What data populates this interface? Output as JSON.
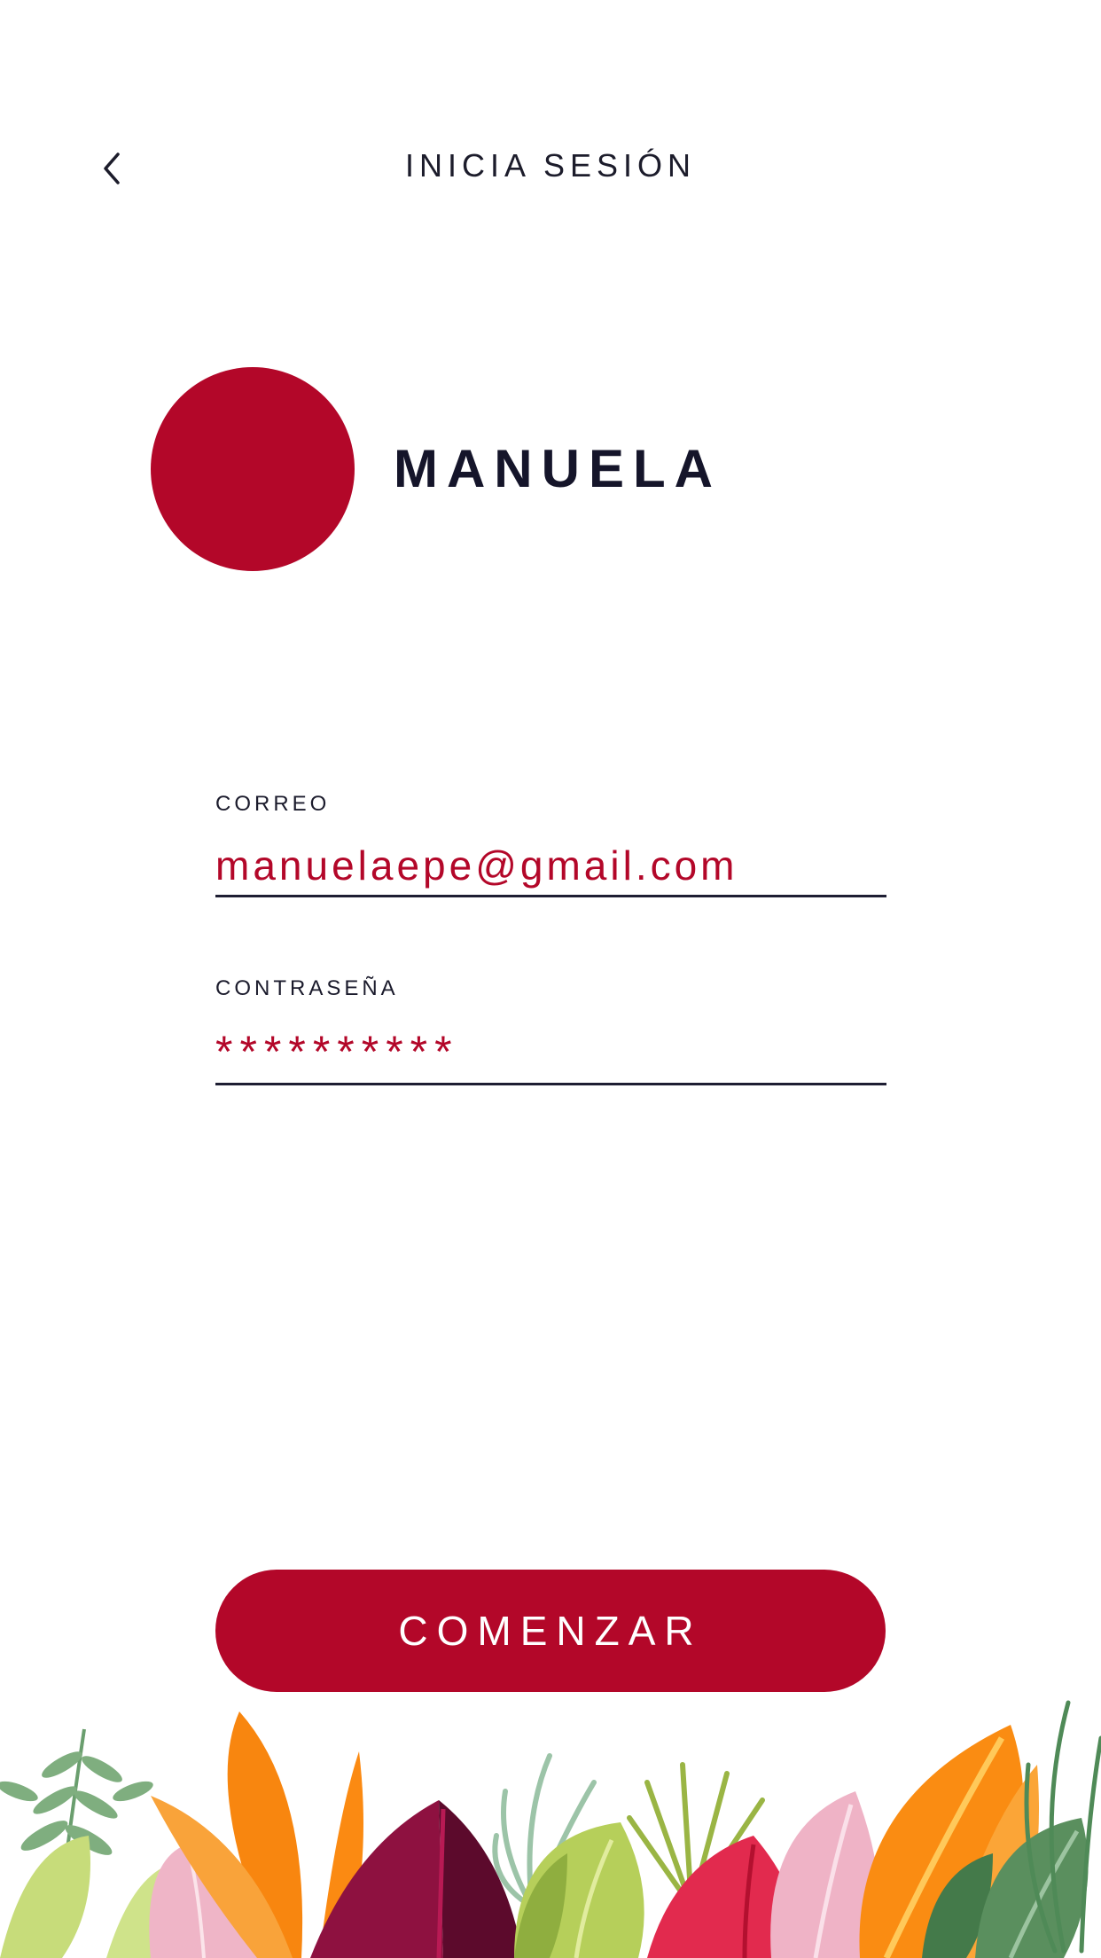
{
  "header": {
    "title": "INICIA SESIÓN",
    "back_icon": "chevron-left-icon"
  },
  "profile": {
    "name": "MANUELA",
    "avatar_color": "#b30729"
  },
  "form": {
    "email": {
      "label": "CORREO",
      "value": "manuelaepe@gmail.com"
    },
    "password": {
      "label": "CONTRASEÑA",
      "value": "**********"
    }
  },
  "actions": {
    "start_label": "COMENZAR",
    "accent": "#b30729"
  },
  "decoration": {
    "name": "tropical-foliage-illustration"
  }
}
